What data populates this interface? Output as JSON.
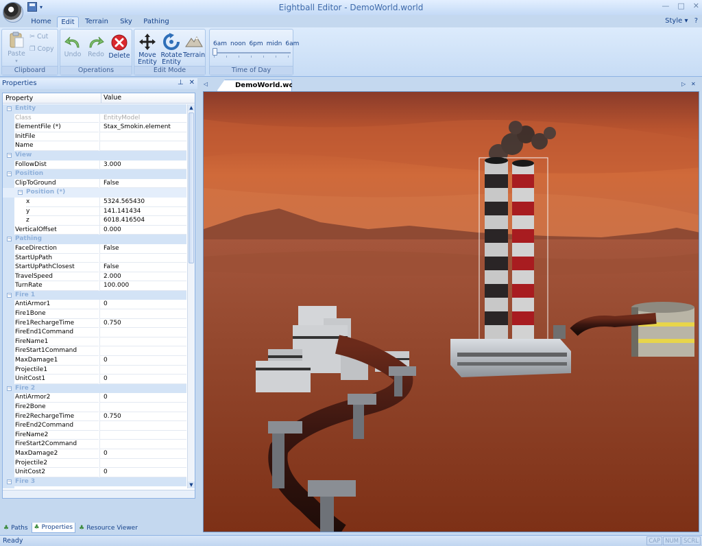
{
  "app": {
    "title": "Eightball Editor - DemoWorld.world",
    "style_label": "Style",
    "window_controls": [
      "minimize-icon",
      "maximize-icon",
      "close-icon"
    ]
  },
  "ribbon": {
    "tabs": [
      "Home",
      "Edit",
      "Terrain",
      "Sky",
      "Pathing"
    ],
    "active_tab": "Edit",
    "groups": {
      "clipboard": {
        "label": "Clipboard",
        "paste": "Paste",
        "cut": "Cut",
        "copy": "Copy"
      },
      "operations": {
        "label": "Operations",
        "undo": "Undo",
        "redo": "Redo",
        "delete": "Delete"
      },
      "edit_mode": {
        "label": "Edit Mode",
        "move_line1": "Move",
        "move_line2": "Entity",
        "rotate_line1": "Rotate",
        "rotate_line2": "Entity",
        "terrain": "Terrain"
      },
      "time_of_day": {
        "label": "Time of Day",
        "ticks": [
          "6am",
          "noon",
          "6pm",
          "midn",
          "6am"
        ],
        "slider_fraction": 0.0
      }
    }
  },
  "properties_panel": {
    "title": "Properties",
    "columns": [
      "Property",
      "Value"
    ],
    "rows": [
      {
        "kind": "cat",
        "name": "Entity"
      },
      {
        "kind": "prop",
        "name": "Class",
        "value": "EntityModel",
        "disabled": true
      },
      {
        "kind": "prop",
        "name": "ElementFile (*)",
        "value": "Stax_Smokin.element"
      },
      {
        "kind": "prop",
        "name": "InitFile",
        "value": ""
      },
      {
        "kind": "prop",
        "name": "Name",
        "value": ""
      },
      {
        "kind": "cat",
        "name": "View"
      },
      {
        "kind": "prop",
        "name": "FollowDist",
        "value": "3.000"
      },
      {
        "kind": "cat",
        "name": "Position"
      },
      {
        "kind": "prop",
        "name": "ClipToGround",
        "value": "False"
      },
      {
        "kind": "sub",
        "name": "Position (*)"
      },
      {
        "kind": "deep",
        "name": "x",
        "value": "5324.565430"
      },
      {
        "kind": "deep",
        "name": "y",
        "value": "141.141434"
      },
      {
        "kind": "deep",
        "name": "z",
        "value": "6018.416504"
      },
      {
        "kind": "prop",
        "name": "VerticalOffset",
        "value": "0.000"
      },
      {
        "kind": "cat",
        "name": "Pathing"
      },
      {
        "kind": "prop",
        "name": "FaceDirection",
        "value": "False"
      },
      {
        "kind": "prop",
        "name": "StartUpPath",
        "value": ""
      },
      {
        "kind": "prop",
        "name": "StartUpPathClosest",
        "value": "False"
      },
      {
        "kind": "prop",
        "name": "TravelSpeed",
        "value": "2.000"
      },
      {
        "kind": "prop",
        "name": "TurnRate",
        "value": "100.000"
      },
      {
        "kind": "cat",
        "name": "Fire 1"
      },
      {
        "kind": "prop",
        "name": "AntiArmor1",
        "value": "0"
      },
      {
        "kind": "prop",
        "name": "Fire1Bone",
        "value": ""
      },
      {
        "kind": "prop",
        "name": "Fire1RechargeTime",
        "value": "0.750"
      },
      {
        "kind": "prop",
        "name": "FireEnd1Command",
        "value": ""
      },
      {
        "kind": "prop",
        "name": "FireName1",
        "value": ""
      },
      {
        "kind": "prop",
        "name": "FireStart1Command",
        "value": ""
      },
      {
        "kind": "prop",
        "name": "MaxDamage1",
        "value": "0"
      },
      {
        "kind": "prop",
        "name": "Projectile1",
        "value": ""
      },
      {
        "kind": "prop",
        "name": "UnitCost1",
        "value": "0"
      },
      {
        "kind": "cat",
        "name": "Fire 2"
      },
      {
        "kind": "prop",
        "name": "AntiArmor2",
        "value": "0"
      },
      {
        "kind": "prop",
        "name": "Fire2Bone",
        "value": ""
      },
      {
        "kind": "prop",
        "name": "Fire2RechargeTime",
        "value": "0.750"
      },
      {
        "kind": "prop",
        "name": "FireEnd2Command",
        "value": ""
      },
      {
        "kind": "prop",
        "name": "FireName2",
        "value": ""
      },
      {
        "kind": "prop",
        "name": "FireStart2Command",
        "value": ""
      },
      {
        "kind": "prop",
        "name": "MaxDamage2",
        "value": "0"
      },
      {
        "kind": "prop",
        "name": "Projectile2",
        "value": ""
      },
      {
        "kind": "prop",
        "name": "UnitCost2",
        "value": "0"
      },
      {
        "kind": "cat",
        "name": "Fire 3"
      }
    ]
  },
  "panel_tabs": [
    {
      "label": "Paths",
      "icon": "paths-icon"
    },
    {
      "label": "Properties",
      "icon": "properties-icon",
      "active": true
    },
    {
      "label": "Resource Viewer",
      "icon": "resource-viewer-icon"
    }
  ],
  "document": {
    "tab_label": "DemoWorld.world"
  },
  "status": {
    "text": "Ready",
    "indicators": [
      "CAP",
      "NUM",
      "SCRL"
    ]
  },
  "colors": {
    "ribbon_blue": "#c4d8ef",
    "delete_red": "#d9282d",
    "terrain_sky": "#b9542f",
    "ground": "#8f3b22"
  }
}
